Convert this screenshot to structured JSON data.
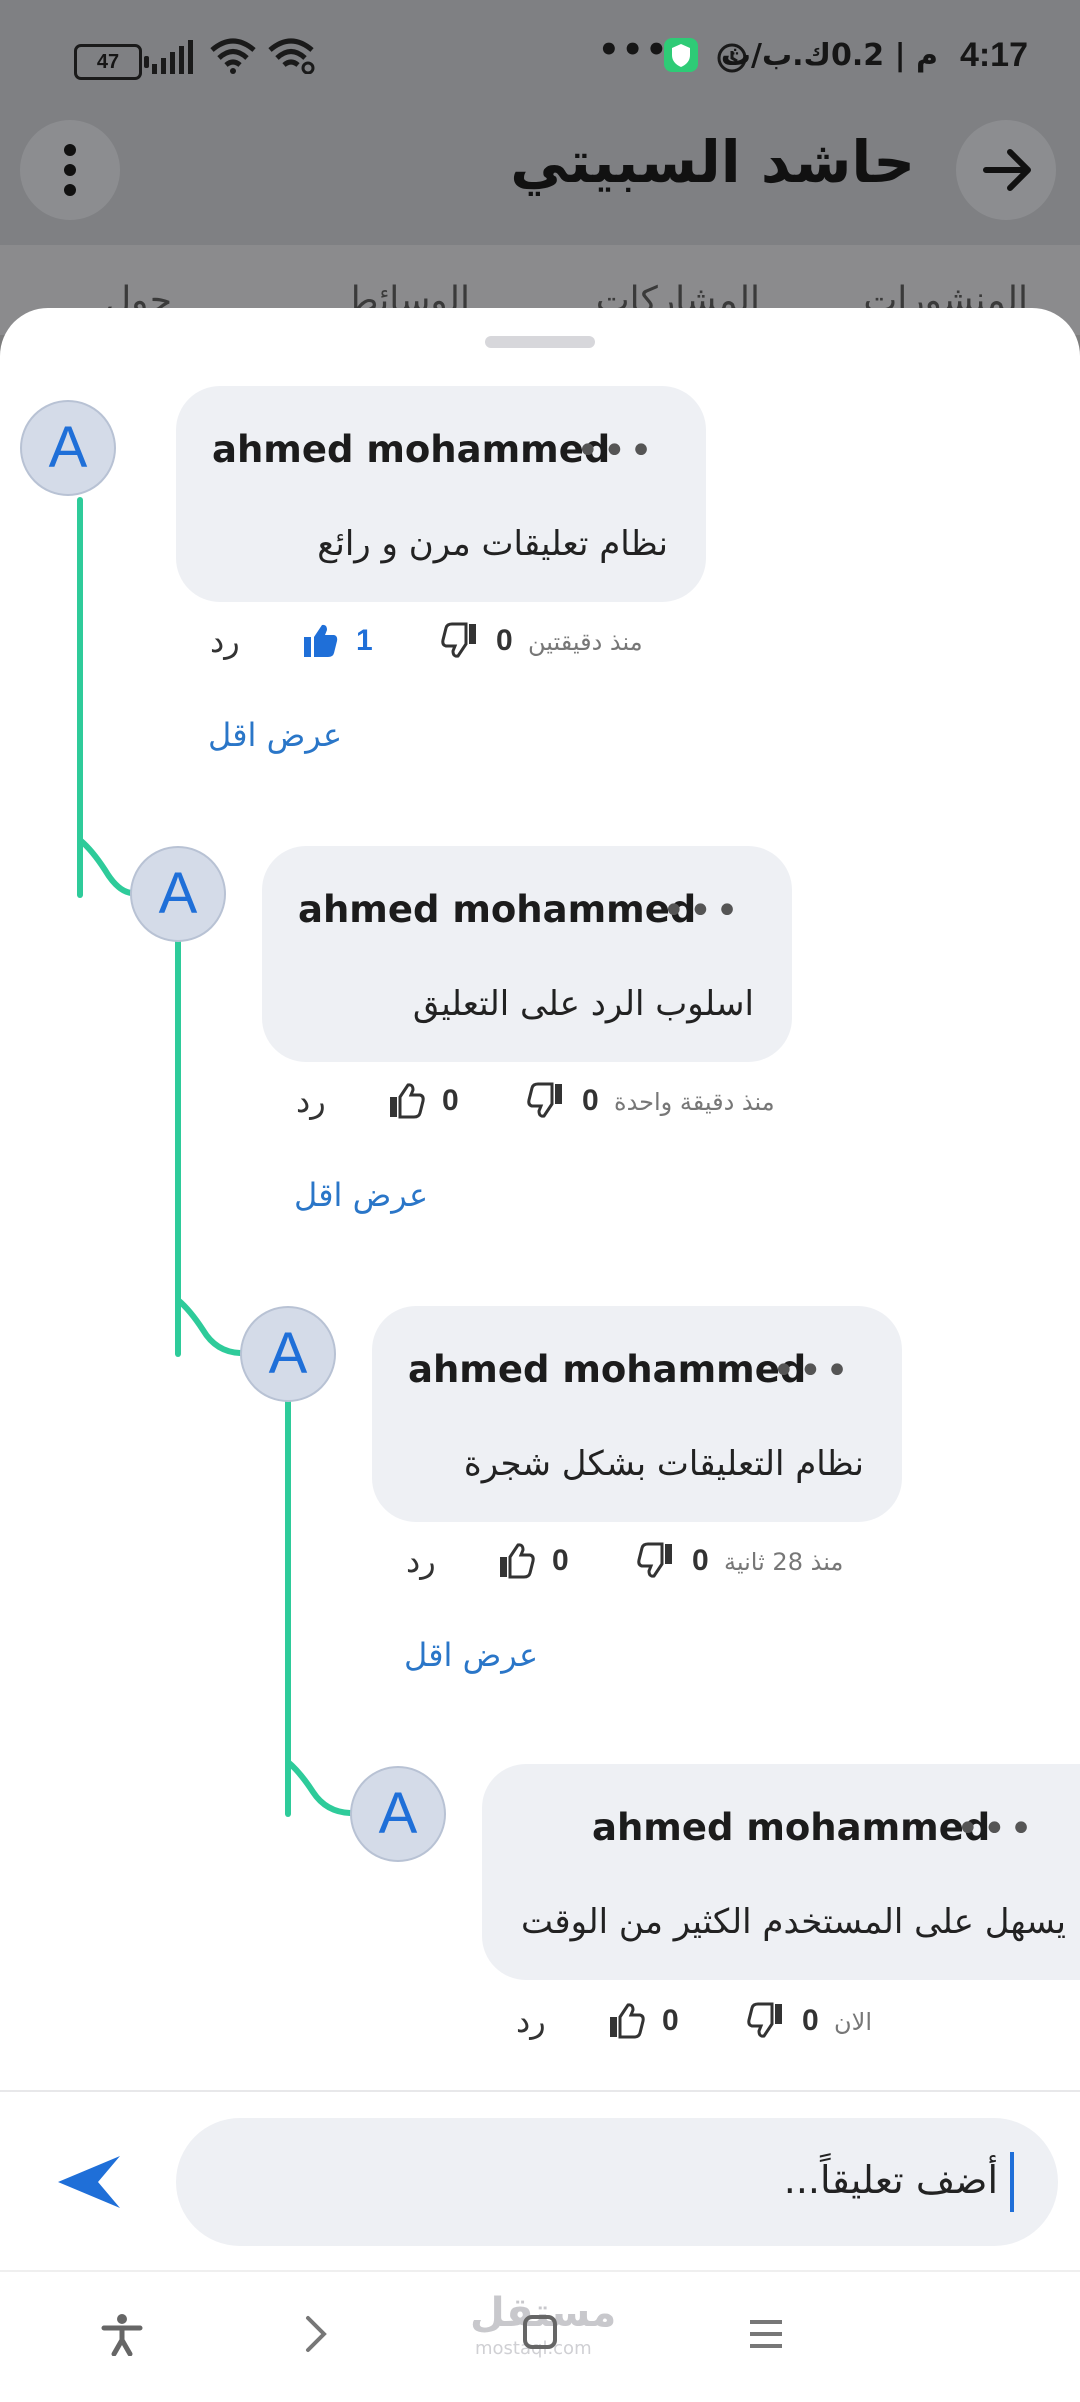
{
  "status_bar": {
    "time": "4:17",
    "network_speed": "م | 0.2ك.ب/ث",
    "battery": "47"
  },
  "header": {
    "title": "حاشد السبيتي"
  },
  "tabs": [
    "المنشورات",
    "المشاركات",
    "الوسائط",
    "حول"
  ],
  "comments": [
    {
      "author": "ahmed mohammed",
      "initial": "A",
      "text": "نظام تعليقات مرن و رائع",
      "time": "منذ دقيقتين",
      "dislikes": "0",
      "likes": "1",
      "reply": "رد",
      "show_less": "عرض اقل"
    },
    {
      "author": "ahmed mohammed",
      "initial": "A",
      "text": "اسلوب الرد على التعليق",
      "time": "منذ دقيقة واحدة",
      "dislikes": "0",
      "likes": "0",
      "reply": "رد",
      "show_less": "عرض اقل"
    },
    {
      "author": "ahmed mohammed",
      "initial": "A",
      "text": "نظام التعليقات بشكل شجرة",
      "time": "منذ 28 ثانية",
      "dislikes": "0",
      "likes": "0",
      "reply": "رد",
      "show_less": "عرض اقل"
    },
    {
      "author": "ahmed mohammed",
      "initial": "A",
      "text": "يسهل على المستخدم الكثير من الوقت",
      "time": "الان",
      "dislikes": "0",
      "likes": "0",
      "reply": "رد"
    }
  ],
  "comment_input": {
    "placeholder": "أضف تعليقاً..."
  },
  "colors": {
    "accent": "#1f6fd8",
    "thread_line": "#2ecb9a",
    "bubble": "#eef0f4"
  },
  "watermark": {
    "text": "مستقل",
    "sub": "mostaql.com"
  }
}
